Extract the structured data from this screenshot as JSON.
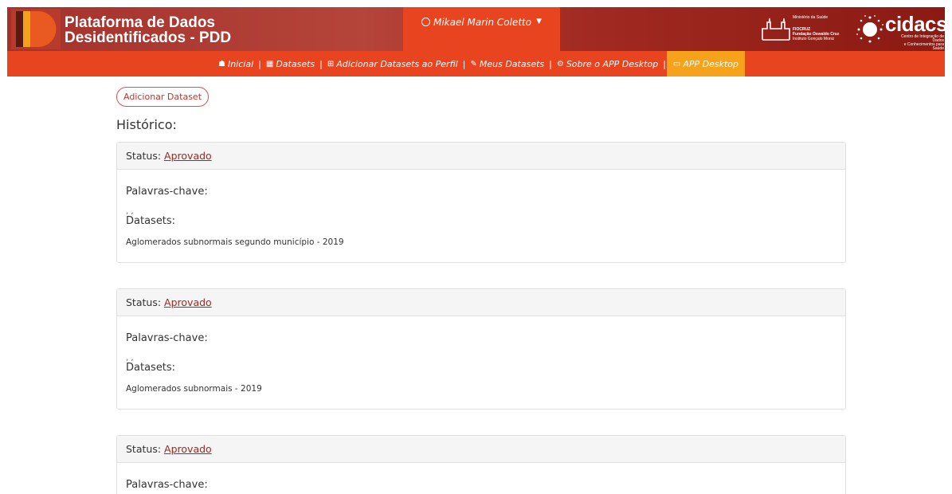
{
  "header": {
    "brand_line1": "Plataforma de Dados",
    "brand_line2": "Desidentificados - PDD",
    "user_name": "Mikael Marin Coletto",
    "fiocruz": {
      "line1": "Ministério da Saúde",
      "line2": "FIOCRUZ",
      "line3": "Fundação Oswaldo Cruz",
      "line4": "Instituto Gonçalo Moniz"
    },
    "cidacs": {
      "word": "cidacs",
      "sub1": "Centro de Integração de Dados",
      "sub2": "e Conhecimentos para Saúde"
    }
  },
  "nav": {
    "items": [
      {
        "label": "Inicial",
        "icon": "home-icon"
      },
      {
        "label": "Datasets",
        "icon": "table-icon"
      },
      {
        "label": "Adicionar Datasets ao Perfil",
        "icon": "file-plus-icon"
      },
      {
        "label": "Meus Datasets",
        "icon": "edit-icon"
      },
      {
        "label": "Sobre o APP Desktop",
        "icon": "gear-icon"
      },
      {
        "label": "APP Desktop",
        "icon": "monitor-icon"
      }
    ],
    "separator": "|"
  },
  "main": {
    "add_button": "Adicionar Dataset",
    "history_title": "Histórico:",
    "cards": [
      {
        "status_label": "Status:",
        "status_value": "Aprovado",
        "keywords_label": "Palavras-chave:",
        "keywords_value": ", ,",
        "datasets_label": "Datasets:",
        "datasets_value": "Aglomerados subnormais segundo município - 2019"
      },
      {
        "status_label": "Status:",
        "status_value": "Aprovado",
        "keywords_label": "Palavras-chave:",
        "keywords_value": ", ,",
        "datasets_label": "Datasets:",
        "datasets_value": "Aglomerados subnormais - 2019"
      },
      {
        "status_label": "Status:",
        "status_value": "Aprovado",
        "keywords_label": "Palavras-chave:"
      }
    ]
  },
  "colors": {
    "header_red": "#a3322c",
    "nav_orange": "#e8441f",
    "active_yellow": "#f7a21b",
    "link_red": "#a1271f"
  }
}
